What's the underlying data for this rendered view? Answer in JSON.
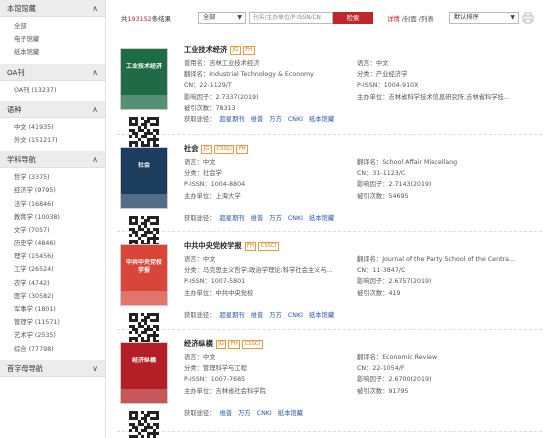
{
  "sidebar": {
    "sections": [
      {
        "title": "本馆馆藏",
        "chevron": "∧",
        "items": [
          "全部",
          "电子馆藏",
          "纸本馆藏"
        ]
      },
      {
        "title": "OA刊",
        "chevron": "∧",
        "items": [
          "OA刊 (13237)"
        ]
      },
      {
        "title": "语种",
        "chevron": "∧",
        "items": [
          "中文 (41935)",
          "外文 (151217)"
        ]
      },
      {
        "title": "学科导航",
        "chevron": "∧",
        "items": [
          "哲学 (3375)",
          "经济学 (9795)",
          "法学 (16846)",
          "教育学 (10038)",
          "文学 (7057)",
          "历史学 (4846)",
          "理学 (15456)",
          "工学 (26524)",
          "农学 (4742)",
          "医学 (30582)",
          "军事学 (1801)",
          "管理学 (11571)",
          "艺术学 (2535)",
          "综合 (77798)"
        ]
      },
      {
        "title": "首字母导航",
        "chevron": "∨",
        "items": []
      }
    ]
  },
  "toolbar": {
    "total_prefix": "共",
    "total_count": "193152",
    "total_suffix": "条结果",
    "scope_select": "全部",
    "search_placeholder": "刊名/主办单位/P-ISSN/CN",
    "search_button": "检索",
    "view_detail": "详情",
    "view_sep1": " /封面 /列表",
    "sort_select": "默认排序",
    "icon": "print-icon"
  },
  "journals": [
    {
      "title": "工业技术经济",
      "badges": [
        "JG",
        "FH"
      ],
      "cover_text": "工业技术经济",
      "cover_color": "#1e6b45",
      "left_rows": [
        "曾用名：吉林工业技术经济",
        "翻译名：Industrial Technology & Economy",
        "CN：22-1129/T",
        "影响因子：2.7337(2019)",
        "被引次数：78313"
      ],
      "right_rows": [
        "语言：中文",
        "分类：产业经济学",
        "P-ISSN：1004-910X",
        "主办单位：吉林省科学技术信息研究所;吉林省科学技..."
      ],
      "acquire_label": "获取途径：",
      "acquire_links": [
        "超星期刊",
        "维普",
        "万方",
        "CNKI",
        "纸本馆藏"
      ]
    },
    {
      "title": "社会",
      "badges": [
        "JG",
        "CSSCI",
        "FH"
      ],
      "cover_text": "社会",
      "cover_color": "#1b3d5e",
      "left_rows": [
        "语言：中文",
        "分类：社会学",
        "P-ISSN：1004-8804",
        "主办单位：上海大学"
      ],
      "right_rows": [
        "翻译名：School Affair Miscellang",
        "CN：31-1123/C",
        "影响因子：2.7143(2019)",
        "被引次数：54695"
      ],
      "acquire_label": "获取途径：",
      "acquire_links": [
        "超星期刊",
        "维普",
        "万方",
        "CNKI",
        "纸本馆藏"
      ]
    },
    {
      "title": "中共中央党校学报",
      "badges": [
        "FH",
        "CSSCI"
      ],
      "cover_text": "中共中央党校学报",
      "cover_color": "#d8463a",
      "left_rows": [
        "语言：中文",
        "分类：马克思主义哲学;政治学理论;科学社会主义与...",
        "P-ISSN：1007-5801",
        "主办单位：中共中央党校"
      ],
      "right_rows": [
        "翻译名：Journal of the Party School of the Centra...",
        "CN：11-3847/C",
        "影响因子：2.6757(2019)",
        "被引次数：419"
      ],
      "acquire_label": "获取途径：",
      "acquire_links": [
        "超星期刊",
        "维普",
        "万方",
        "CNKI",
        "纸本馆藏"
      ]
    },
    {
      "title": "经济纵横",
      "badges": [
        "JG",
        "FH",
        "CSSCI"
      ],
      "cover_text": "经济纵横",
      "cover_color": "#b31f24",
      "left_rows": [
        "语言：中文",
        "分类：管理科学与工程",
        "P-ISSN：1007-7685",
        "主办单位：吉林省社会科学院"
      ],
      "right_rows": [
        "翻译名：Economic Review",
        "CN：22-1054/F",
        "影响因子：2.6700(2019)",
        "被引次数：91795"
      ],
      "acquire_label": "获取途径：",
      "acquire_links": [
        "维普",
        "万方",
        "CNKI",
        "纸本馆藏"
      ]
    }
  ]
}
